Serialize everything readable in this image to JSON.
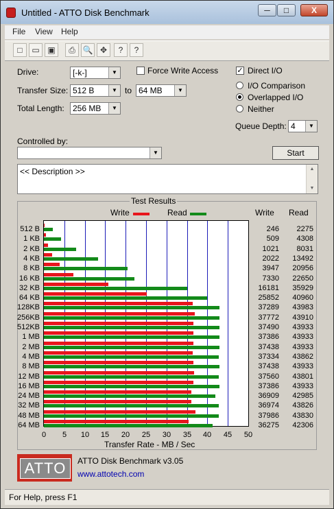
{
  "window": {
    "title": "Untitled - ATTO Disk Benchmark",
    "minimize": "─",
    "maximize": "□",
    "close": "X"
  },
  "menu": [
    "File",
    "View",
    "Help"
  ],
  "toolbar": [
    "new-icon",
    "open-icon",
    "save-icon",
    "print-icon",
    "print-preview-icon",
    "move-icon",
    "help-icon",
    "context-help-icon"
  ],
  "toolbar_glyphs": [
    "□",
    "▭",
    "▣",
    "⎙",
    "🔍",
    "✥",
    "?",
    "?"
  ],
  "settings": {
    "drive_label": "Drive:",
    "drive_value": "[-k-]",
    "force_write_label": "Force Write Access",
    "force_write_checked": false,
    "direct_io_label": "Direct I/O",
    "direct_io_checked": true,
    "transfer_size_label": "Transfer Size:",
    "transfer_from": "512 B",
    "to_label": "to",
    "transfer_to": "64 MB",
    "io_comparison_label": "I/O Comparison",
    "overlapped_io_label": "Overlapped I/O",
    "neither_label": "Neither",
    "selected_mode": "Overlapped I/O",
    "total_length_label": "Total Length:",
    "total_length_value": "256 MB",
    "queue_depth_label": "Queue Depth:",
    "queue_depth_value": "4",
    "controlled_by_label": "Controlled by:",
    "controlled_by_value": "",
    "start_label": "Start",
    "description_text": "<< Description >>"
  },
  "colors": {
    "write": "#e8161c",
    "read": "#138a1a"
  },
  "chart_data": {
    "type": "bar",
    "title": "Test Results",
    "xlabel": "Transfer Rate - MB / Sec",
    "xlim": [
      0,
      50
    ],
    "xticks": [
      "0",
      "5",
      "10",
      "15",
      "20",
      "25",
      "30",
      "35",
      "40",
      "45",
      "50"
    ],
    "legend": [
      "Write",
      "Read"
    ],
    "col_headers": [
      "Write",
      "Read"
    ],
    "categories": [
      "512 B",
      "1 KB",
      "2 KB",
      "4 KB",
      "8 KB",
      "16 KB",
      "32 KB",
      "64 KB",
      "128KB",
      "256KB",
      "512KB",
      "1 MB",
      "2 MB",
      "4 MB",
      "8 MB",
      "12 MB",
      "16 MB",
      "24 MB",
      "32 MB",
      "48 MB",
      "64 MB"
    ],
    "series": [
      {
        "name": "Write",
        "values": [
          246,
          509,
          1021,
          2022,
          3947,
          7330,
          16181,
          25852,
          37289,
          37772,
          37490,
          37386,
          37438,
          37334,
          37438,
          37560,
          37386,
          36909,
          36974,
          37986,
          36275
        ]
      },
      {
        "name": "Read",
        "values": [
          2275,
          4308,
          8031,
          13492,
          20956,
          22650,
          35929,
          40960,
          43983,
          43910,
          43933,
          43933,
          43933,
          43862,
          43933,
          43801,
          43933,
          42985,
          43826,
          43830,
          42306
        ]
      }
    ]
  },
  "footer": {
    "product": "ATTO Disk Benchmark v3.05",
    "url": "www.attotech.com",
    "logo_text": "ATTO"
  },
  "status": "For Help, press F1"
}
